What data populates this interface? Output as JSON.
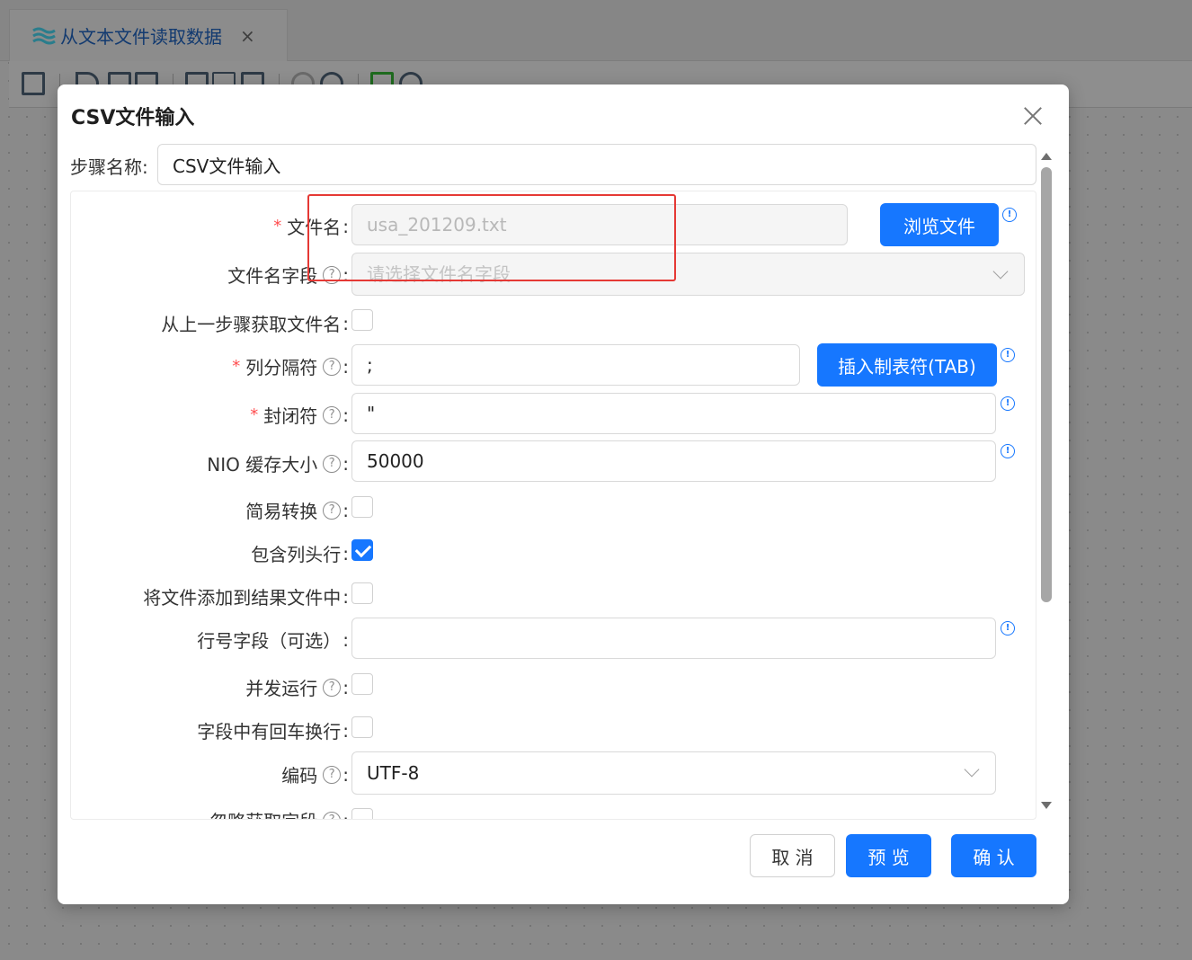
{
  "tab": {
    "label": "从文本文件读取数据",
    "close": "×"
  },
  "dialog": {
    "title": "CSV文件输入",
    "step_name_label": "步骤名称",
    "step_name_value": "CSV文件输入",
    "fields": {
      "filename": {
        "label": "文件名",
        "value": "usa_201209.txt",
        "button": "浏览文件"
      },
      "filename_field": {
        "label": "文件名字段",
        "placeholder": "请选择文件名字段"
      },
      "from_prev_step": {
        "label": "从上一步骤获取文件名",
        "checked": false
      },
      "delimiter": {
        "label": "列分隔符",
        "value": ";",
        "button": "插入制表符(TAB)"
      },
      "enclosure": {
        "label": "封闭符",
        "value": "\""
      },
      "nio_buffer": {
        "label": "NIO 缓存大小",
        "value": "50000"
      },
      "lazy_conversion": {
        "label": "简易转换",
        "checked": false
      },
      "header_row": {
        "label": "包含列头行",
        "checked": true
      },
      "add_to_result": {
        "label": "将文件添加到结果文件中",
        "checked": false
      },
      "row_num_field": {
        "label": "行号字段（可选）",
        "value": ""
      },
      "parallel": {
        "label": "并发运行",
        "checked": false
      },
      "newline_in_field": {
        "label": "字段中有回车换行",
        "checked": false
      },
      "encoding": {
        "label": "编码",
        "value": "UTF-8"
      },
      "ignore_fields": {
        "label": "忽略获取字段",
        "checked": false
      }
    },
    "buttons": {
      "cancel": "取 消",
      "preview": "预 览",
      "confirm": "确 认"
    }
  },
  "colors": {
    "primary": "#1677ff",
    "required": "#ff4d4f",
    "highlight": "#e53935"
  }
}
